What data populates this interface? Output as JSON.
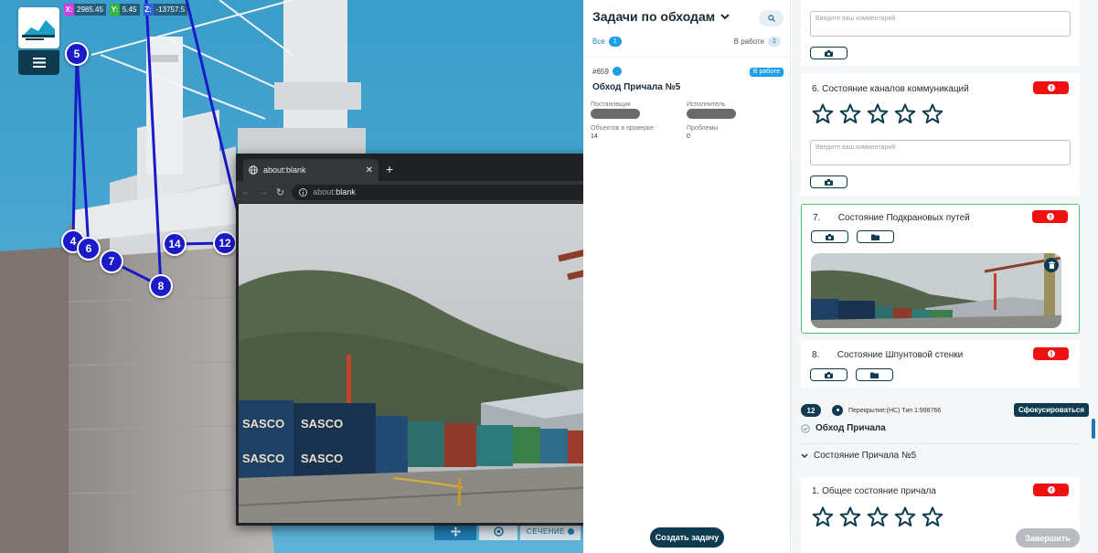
{
  "viewport": {
    "coords": {
      "x_label": "X:",
      "x": "2985.45",
      "y_label": "Y:",
      "y": "5.45",
      "z_label": "Z:",
      "z": "-13757.5"
    },
    "markers": [
      "5",
      "4",
      "6",
      "7",
      "8",
      "14",
      "12"
    ],
    "tools": {
      "move_icon": "move-icon",
      "target_icon": "target-icon",
      "section_label": "СЕЧЕНИЕ"
    }
  },
  "browser": {
    "tab_title": "about:blank",
    "new_tab": "+",
    "url_scheme": "about:",
    "url_host": "blank",
    "window_controls": [
      "—",
      "☐",
      "✕"
    ]
  },
  "tasks": {
    "header_title": "Задачи по обходам",
    "filter_all_label": "Все",
    "filter_all_count": "1",
    "filter_work_label": "В работе",
    "filter_work_count": "1",
    "card": {
      "id": "#659",
      "status": "В работе",
      "title": "Обход Причала №5",
      "assigner_label": "Постановщик",
      "executor_label": "Исполнитель",
      "objects_label": "Объектов в проверке",
      "objects_value": "14",
      "problems_label": "Проблемы",
      "problems_value": "0"
    },
    "create_button": "Создать задачу"
  },
  "form": {
    "comment_placeholder": "Введите ваш комментарий",
    "items": [
      {
        "number": "6.",
        "title": "Состояние каналов коммуникаций"
      },
      {
        "number": "7.",
        "title": "Состояние Подкрановых путей"
      },
      {
        "number": "8.",
        "title": "Состояние Шпунтовой стенки"
      },
      {
        "number": "1.",
        "title": "Общее состояние причала"
      }
    ],
    "meta": {
      "badge": "12",
      "text": "Перекрытие:(НС) Тип 1:998766",
      "focus_button": "Сфокусироваться"
    },
    "section_title": "Обход Причала",
    "subsection_title": "Состояние Причала №5",
    "finish_button": "Завершить"
  }
}
